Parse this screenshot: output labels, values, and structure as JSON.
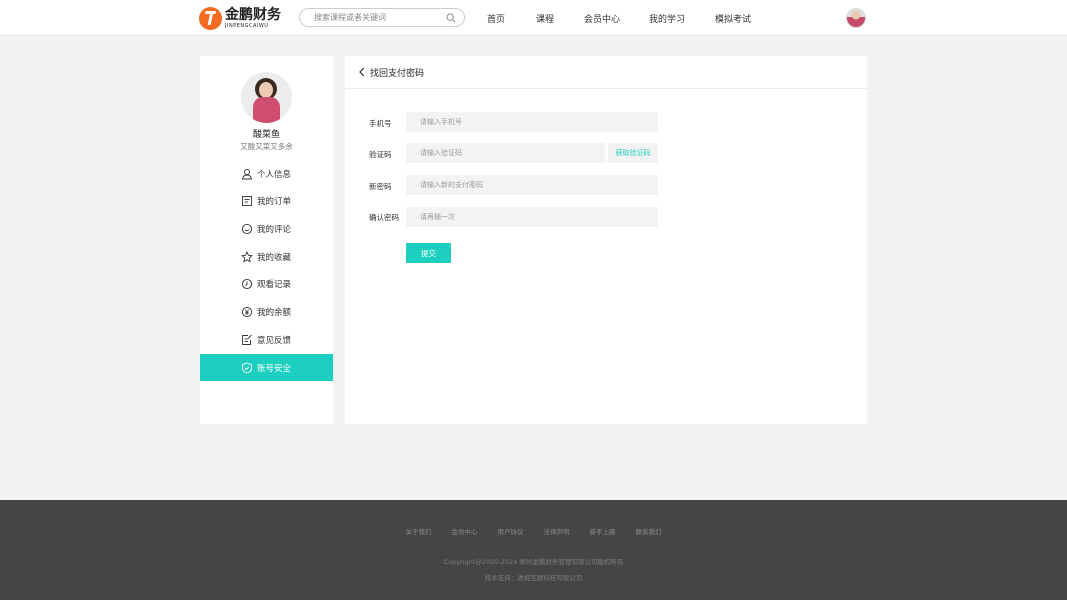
{
  "header": {
    "logo_text": "金鹏财务",
    "logo_sub": "JINPENGCAIWU",
    "search_placeholder": "搜索课程或者关键词",
    "nav": [
      "首页",
      "课程",
      "会员中心",
      "我的学习",
      "模拟考试"
    ]
  },
  "user": {
    "name": "酸菜鱼",
    "bio": "又酸又菜又多余"
  },
  "menu": [
    {
      "label": "个人信息",
      "icon": "user-icon"
    },
    {
      "label": "我的订单",
      "icon": "order-icon"
    },
    {
      "label": "我的评论",
      "icon": "comment-icon"
    },
    {
      "label": "我的收藏",
      "icon": "star-icon"
    },
    {
      "label": "观看记录",
      "icon": "clock-icon"
    },
    {
      "label": "我的余额",
      "icon": "yen-icon"
    },
    {
      "label": "意见反馈",
      "icon": "feedback-icon"
    },
    {
      "label": "账号安全",
      "icon": "shield-icon",
      "active": true
    }
  ],
  "panel": {
    "title": "找回支付密码",
    "fields": [
      {
        "label": "手机号",
        "placeholder": "请输入手机号"
      },
      {
        "label": "验证码",
        "placeholder": "请输入验证码"
      },
      {
        "label": "新密码",
        "placeholder": "请输入新的支付密码"
      },
      {
        "label": "确认密码",
        "placeholder": "请再输一次"
      }
    ],
    "get_code_label": "获取验证码",
    "submit_label": "提交"
  },
  "footer": {
    "links": [
      "关于我们",
      "会员中心",
      "用户协议",
      "法律声明",
      "新手上路",
      "联系我们"
    ],
    "copyright": "Copyright@2020-2024 郑州金鹏财务管理有限公司版权所有",
    "support": "技术支持：透视互联科技有限公司"
  },
  "colors": {
    "accent": "#1dcfbf",
    "logo": "#f26b21",
    "footer_bg": "#444546"
  }
}
